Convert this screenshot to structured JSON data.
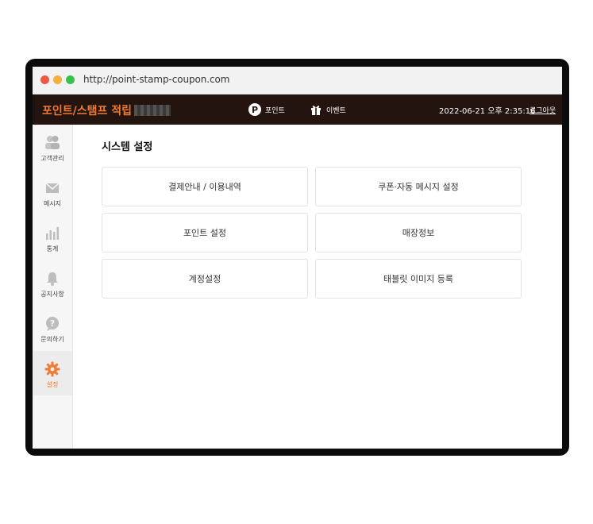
{
  "browser": {
    "url": "http://point-stamp-coupon.com"
  },
  "header": {
    "title": "포인트/스탬프 적립",
    "nav": [
      {
        "label": "포인트",
        "icon": "p-circle-icon"
      },
      {
        "label": "이벤트",
        "icon": "gift-icon"
      }
    ],
    "datetime": "2022-06-21 오후 2:35:16",
    "logout_label": "로그아웃"
  },
  "sidebar": {
    "items": [
      {
        "label": "고객관리",
        "icon": "users-icon"
      },
      {
        "label": "메시지",
        "icon": "envelope-icon"
      },
      {
        "label": "통계",
        "icon": "bar-chart-icon"
      },
      {
        "label": "공지사항",
        "icon": "bell-icon"
      },
      {
        "label": "문의하기",
        "icon": "question-icon"
      },
      {
        "label": "설정",
        "icon": "gear-icon",
        "active": true
      }
    ]
  },
  "main": {
    "title": "시스템 설정",
    "tiles": [
      {
        "label": "결제안내 / 이용내역"
      },
      {
        "label": "쿠폰·자동 메시지 설정"
      },
      {
        "label": "포인트 설정"
      },
      {
        "label": "매장정보"
      },
      {
        "label": "계정설정"
      },
      {
        "label": "태블릿 이미지 등록"
      }
    ]
  },
  "colors": {
    "accent": "#f07a34",
    "header_bg": "#24140f",
    "frame": "#0b0b0b"
  }
}
